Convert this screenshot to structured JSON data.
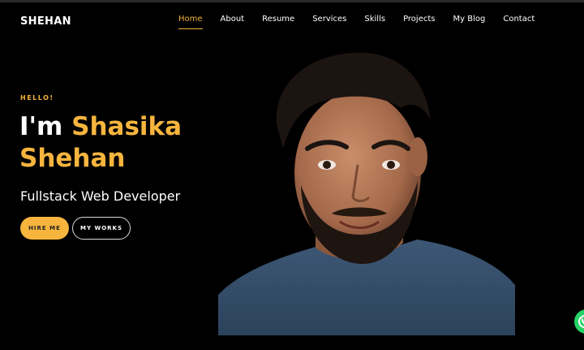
{
  "header": {
    "logo": "SHEHAN",
    "nav": [
      {
        "label": "Home",
        "active": true
      },
      {
        "label": "About",
        "active": false
      },
      {
        "label": "Resume",
        "active": false
      },
      {
        "label": "Services",
        "active": false
      },
      {
        "label": "Skills",
        "active": false
      },
      {
        "label": "Projects",
        "active": false
      },
      {
        "label": "My Blog",
        "active": false
      },
      {
        "label": "Contact",
        "active": false
      }
    ]
  },
  "hero": {
    "greeting": "HELLO!",
    "intro": "I'm",
    "first_name": "Shasika",
    "last_name": "Shehan",
    "role": "Fullstack Web Developer",
    "hire_button": "HIRE ME",
    "works_button": "MY WORKS"
  },
  "colors": {
    "accent": "#f7b53e",
    "background": "#000000",
    "whatsapp": "#25d366"
  },
  "icons": {
    "chat": "whatsapp-icon"
  }
}
